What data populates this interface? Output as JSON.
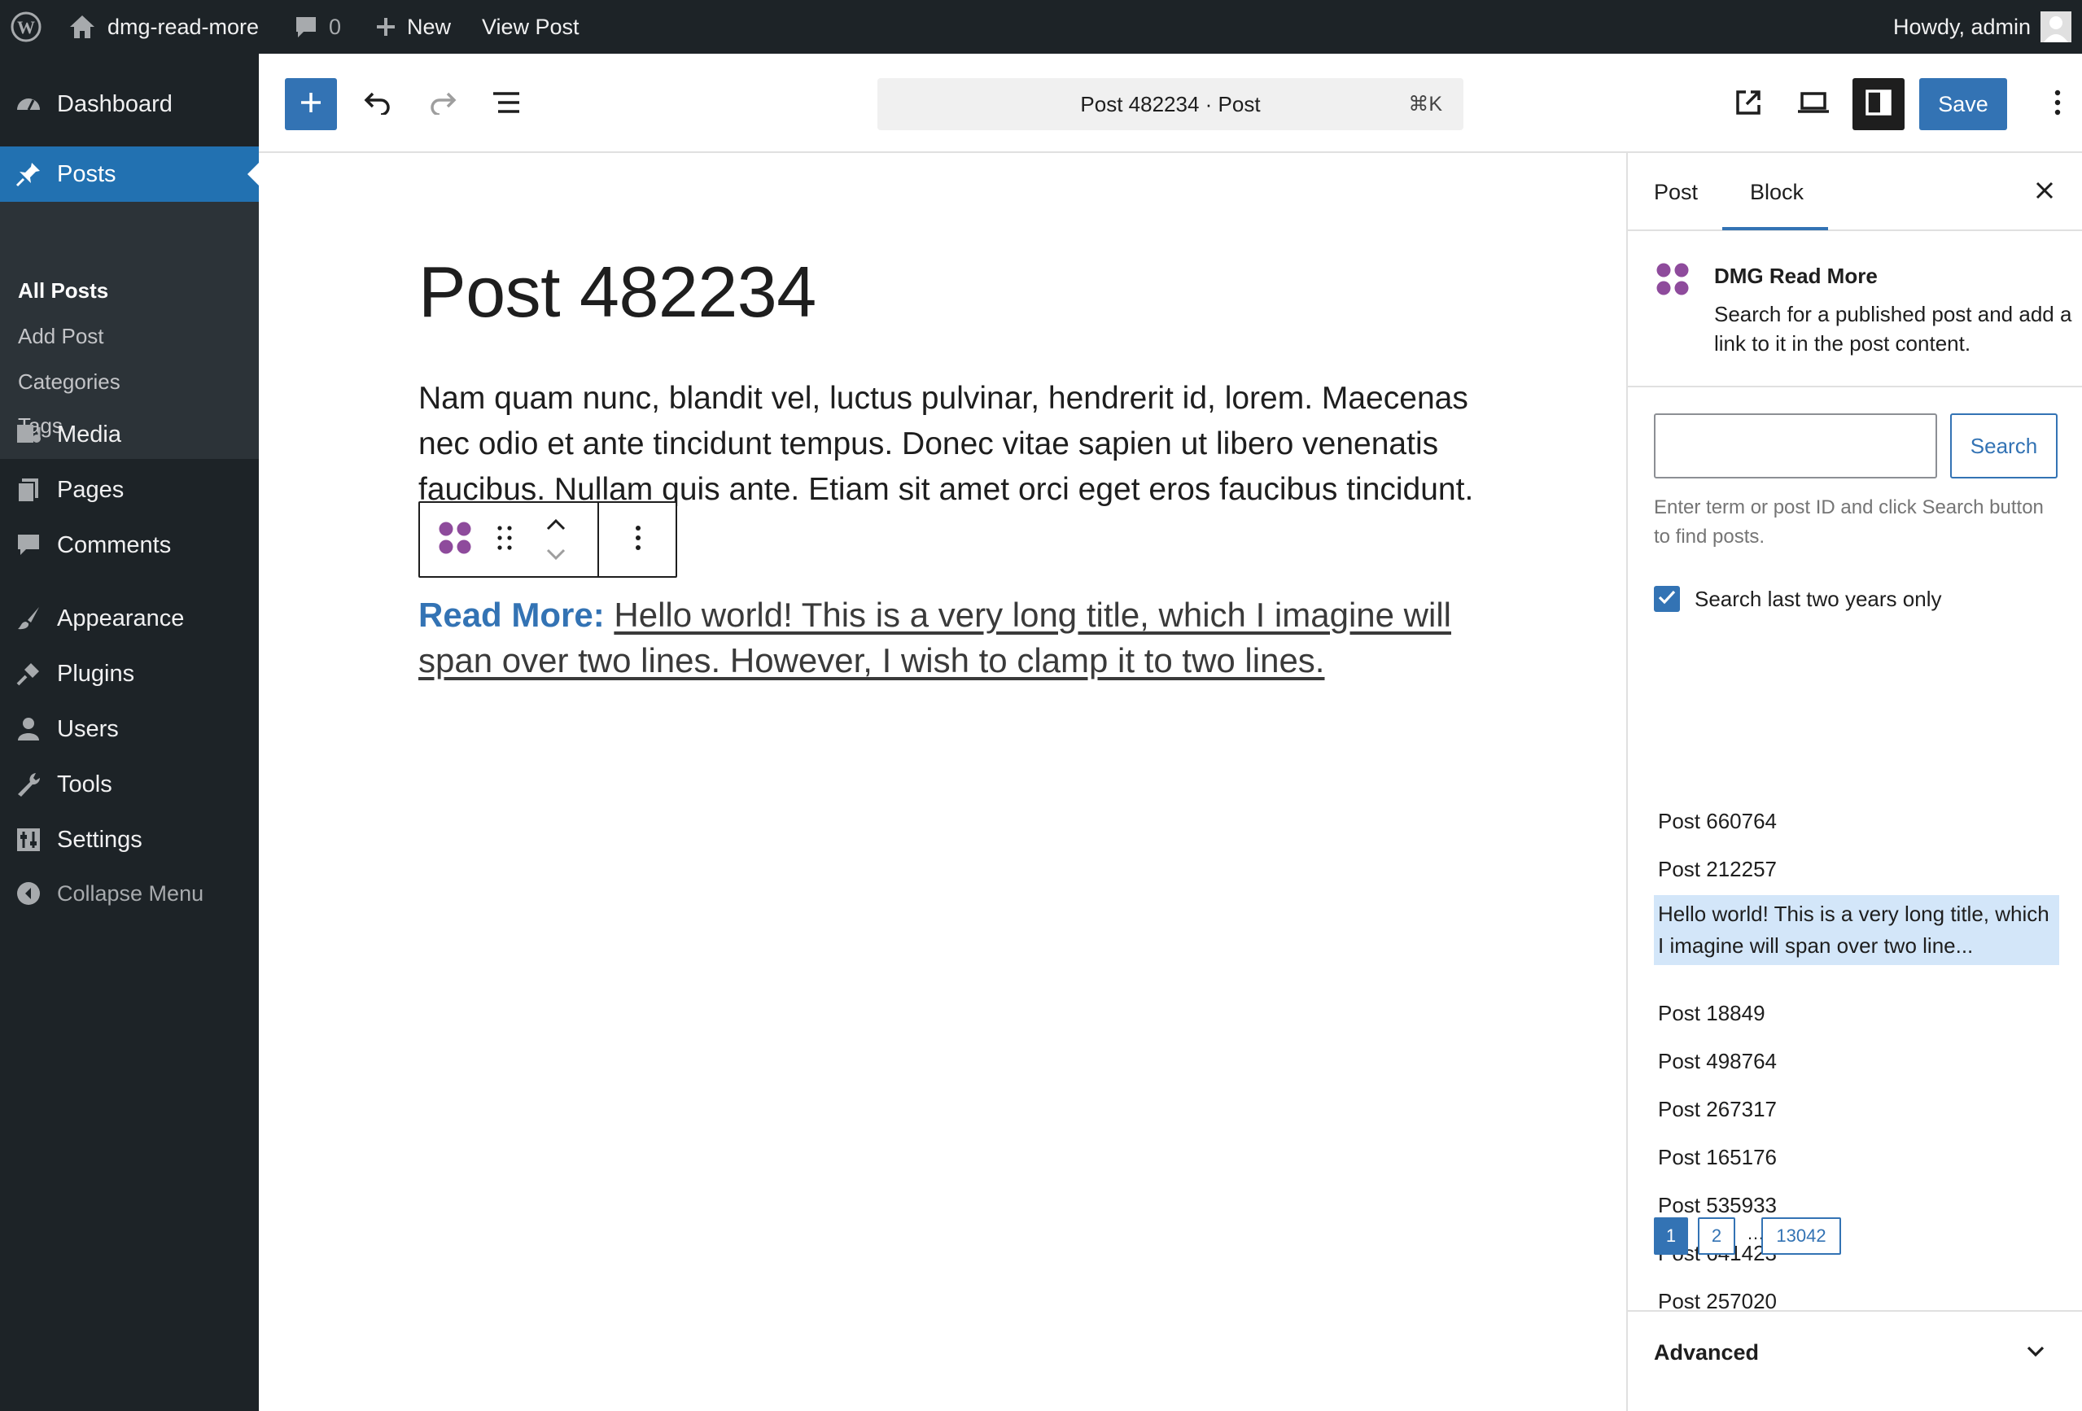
{
  "admin_bar": {
    "site_name": "dmg-read-more",
    "comments_count": "0",
    "new_label": "New",
    "view_post_label": "View Post",
    "greeting": "Howdy, admin"
  },
  "sidebar": {
    "dashboard": "Dashboard",
    "posts": "Posts",
    "submenu": [
      "All Posts",
      "Add Post",
      "Categories",
      "Tags"
    ],
    "media": "Media",
    "pages": "Pages",
    "comments": "Comments",
    "appearance": "Appearance",
    "plugins": "Plugins",
    "users": "Users",
    "tools": "Tools",
    "settings": "Settings",
    "collapse": "Collapse Menu"
  },
  "toolbar": {
    "command_title": "Post 482234 · Post",
    "command_shortcut": "⌘K",
    "save_label": "Save"
  },
  "editor": {
    "title": "Post 482234",
    "paragraph": "Nam quam nunc, blandit vel, luctus pulvinar, hendrerit id, lorem. Maecenas nec odio et ante tincidunt tempus. Donec vitae sapien ut libero venenatis faucibus. Nullam quis ante. Etiam sit amet orci eget eros faucibus tincidunt.",
    "read_more_label": "Read More:",
    "read_more_link": "Hello world! This is a very long title, which I imagine will span over two lines. However, I wish to clamp it to two lines."
  },
  "panel": {
    "tabs": [
      "Post",
      "Block"
    ],
    "active_tab": "Block",
    "block_name": "DMG Read More",
    "block_description": "Search for a published post and add a link to it in the post content.",
    "search_value": "",
    "search_button": "Search",
    "search_help": "Enter term or post ID and click Search button to find posts.",
    "checkbox_label": "Search last two years only",
    "checkbox_checked": true,
    "results": [
      "Post 660764",
      "Post 212257",
      "Hello world! This is a very long title, which I imagine will span over two line...",
      "Post 18849",
      "Post 498764",
      "Post 267317",
      "Post 165176",
      "Post 535933",
      "Post 641423",
      "Post 257020"
    ],
    "selected_result_index": 2,
    "pagination": [
      "1",
      "2",
      "…",
      "13042"
    ],
    "current_page": "1",
    "advanced_label": "Advanced"
  },
  "colors": {
    "admin_dark": "#1d2327",
    "accent": "#3373b4",
    "wp_blue": "#2271b1",
    "block_icon": "#8e4b9c",
    "selected_row": "#d3e6f9"
  }
}
